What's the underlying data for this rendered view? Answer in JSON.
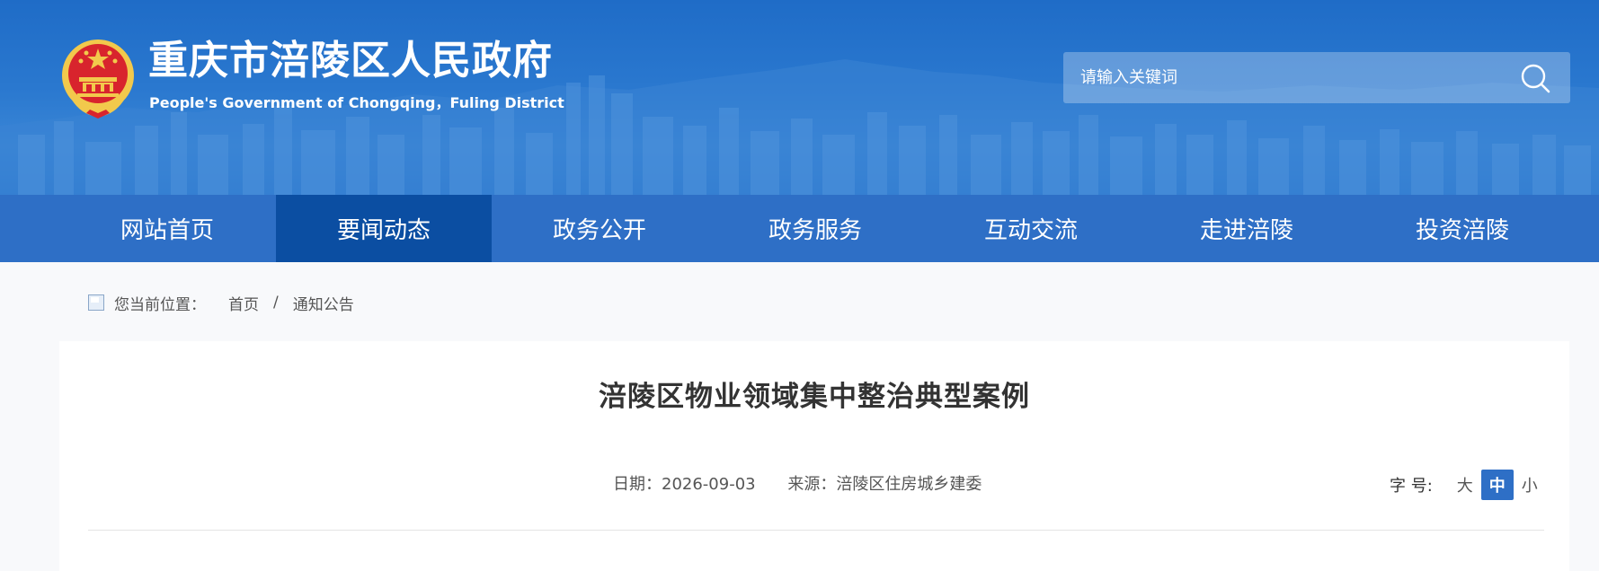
{
  "header": {
    "title": "重庆市涪陵区人民政府",
    "subtitle": "People's Government of Chongqing，Fuling District",
    "emblem_icon": "national-emblem-icon",
    "search": {
      "placeholder": "请输入关键词",
      "icon": "search-icon"
    }
  },
  "nav": {
    "items": [
      {
        "label": "网站首页",
        "active": false
      },
      {
        "label": "要闻动态",
        "active": true
      },
      {
        "label": "政务公开",
        "active": false
      },
      {
        "label": "政务服务",
        "active": false
      },
      {
        "label": "互动交流",
        "active": false
      },
      {
        "label": "走进涪陵",
        "active": false
      },
      {
        "label": "投资涪陵",
        "active": false
      }
    ]
  },
  "breadcrumb": {
    "label": "您当前位置：",
    "items": [
      "首页",
      "通知公告"
    ],
    "separator": "/"
  },
  "article": {
    "title": "涪陵区物业领域集中整治典型案例",
    "date_label": "日期：2026-09-03",
    "source_label": "来源：涪陵区住房城乡建委"
  },
  "font_size": {
    "label": "字 号:",
    "options": [
      "大",
      "中",
      "小"
    ],
    "active": "中"
  },
  "colors": {
    "header_blue": "#1f6cc7",
    "nav_blue": "#2e6fc6",
    "nav_active": "#0b4ea2",
    "font_active": "#2e6fc6"
  }
}
